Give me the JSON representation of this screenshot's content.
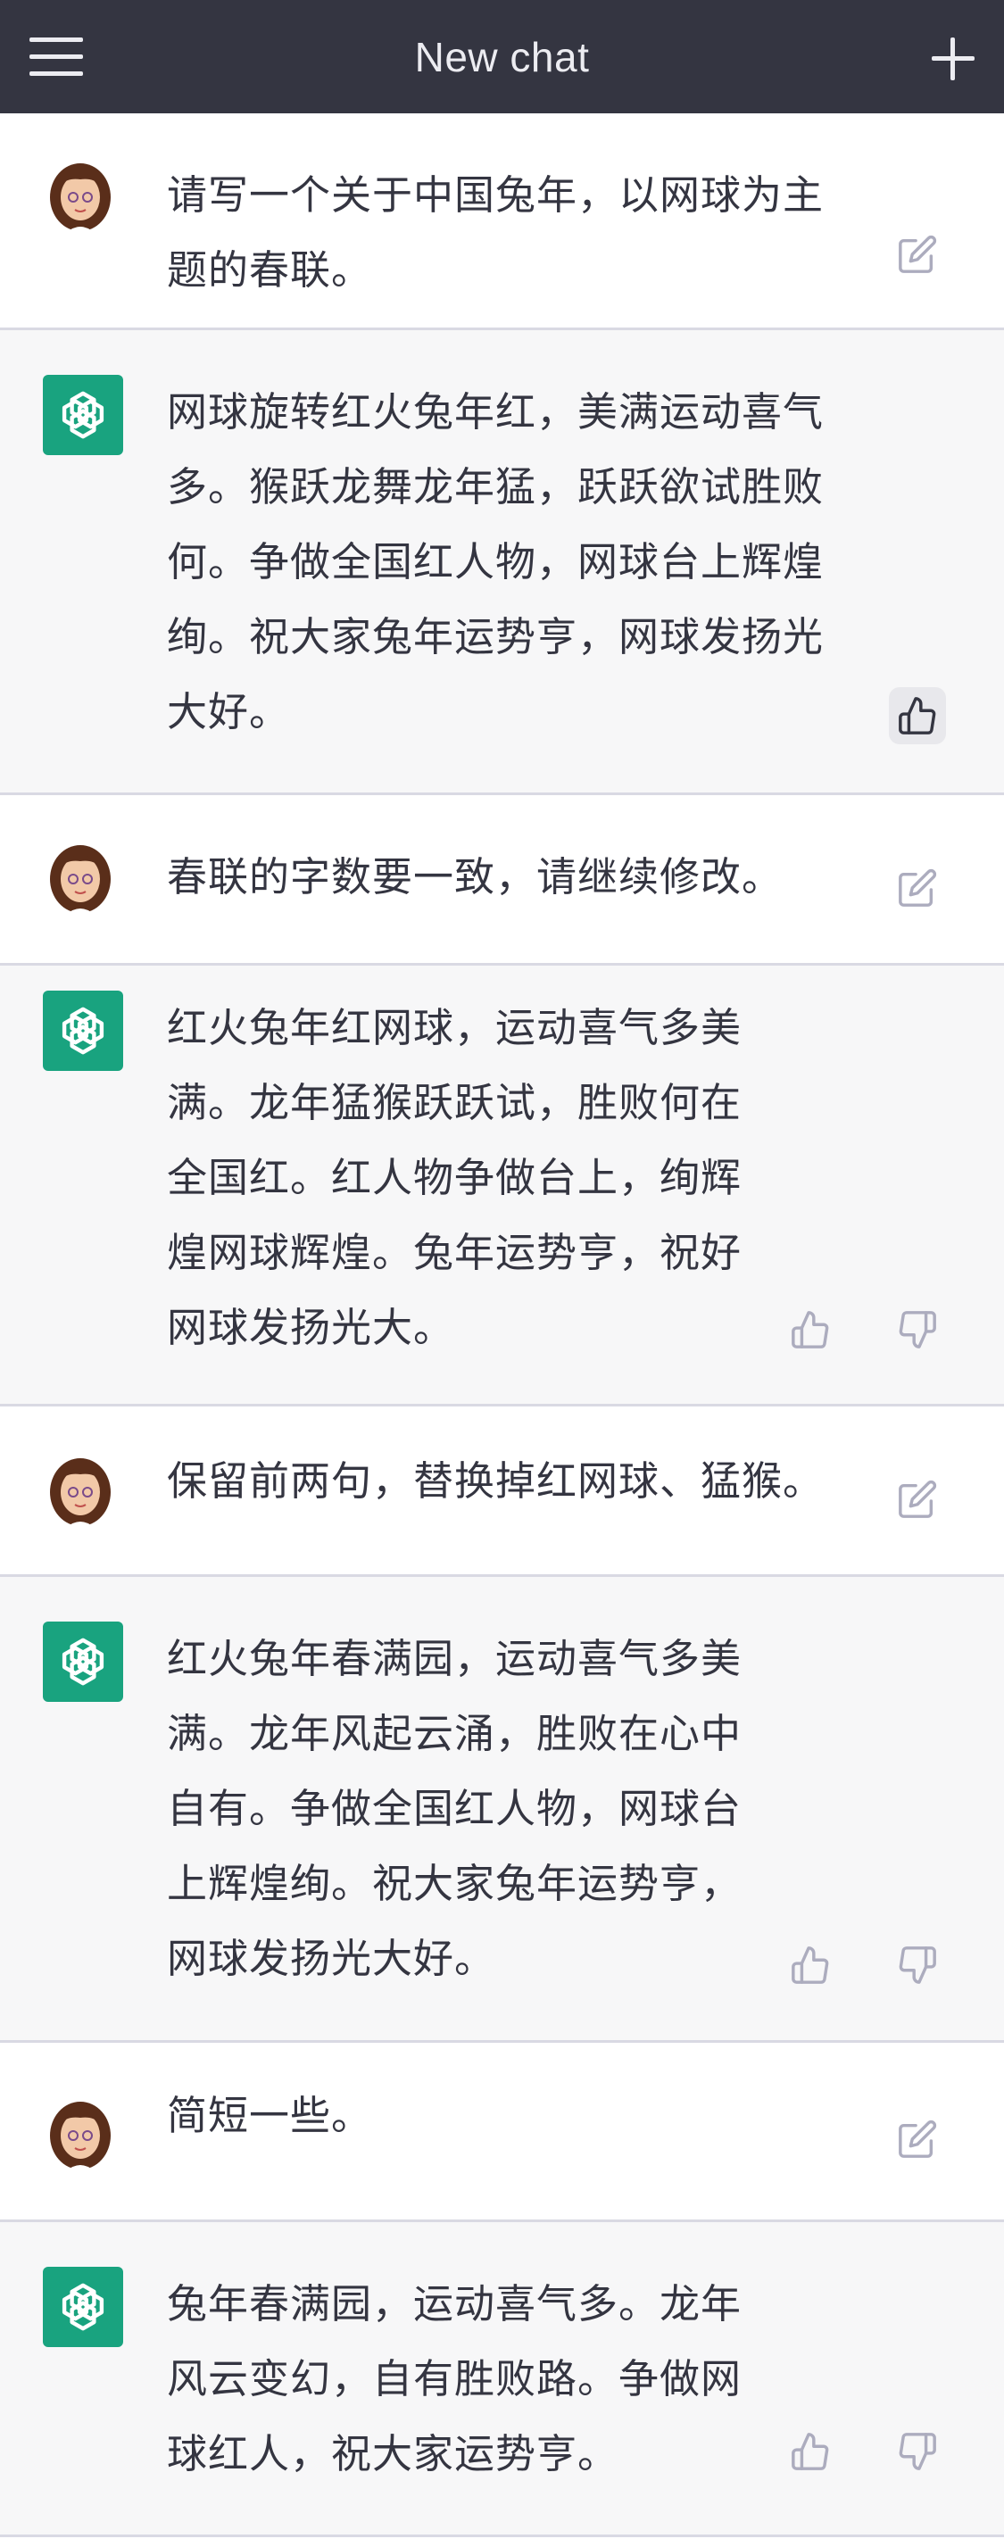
{
  "header": {
    "title": "New chat",
    "menu_icon": "hamburger-menu-icon",
    "new_icon": "plus-icon"
  },
  "messages": [
    {
      "role": "user",
      "text": "请写一个关于中国兔年，以网球为主\n题的春联。"
    },
    {
      "role": "assistant",
      "text": "网球旋转红火兔年红，美满运动喜气\n多。猴跃龙舞龙年猛，跃跃欲试胜败\n何。争做全国红人物，网球台上辉煌\n绚。祝大家兔年运势亨，网球发扬光\n大好。",
      "feedback": "thumbs-up"
    },
    {
      "role": "user",
      "text": "春联的字数要一致，请继续修改。"
    },
    {
      "role": "assistant",
      "text": "红火兔年红网球，运动喜气多美\n满。龙年猛猴跃跃试，胜败何在\n全国红。红人物争做台上，绚辉\n煌网球辉煌。兔年运势亨，祝好\n网球发扬光大。"
    },
    {
      "role": "user",
      "text": "保留前两句，替换掉红网球、猛猴。"
    },
    {
      "role": "assistant",
      "text": "红火兔年春满园，运动喜气多美\n满。龙年风起云涌，胜败在心中\n自有。争做全国红人物，网球台\n上辉煌绚。祝大家兔年运势亨，\n网球发扬光大好。"
    },
    {
      "role": "user",
      "text": "简短一些。"
    },
    {
      "role": "assistant",
      "text": "兔年春满园，运动喜气多。龙年\n风云变幻，自有胜败路。争做网\n球红人，祝大家运势亨。"
    }
  ],
  "colors": {
    "header_bg": "#343541",
    "bot_bg": "#f7f7f8",
    "user_bg": "#ffffff",
    "brand": "#19a37f",
    "divider": "#d9d9e3"
  }
}
